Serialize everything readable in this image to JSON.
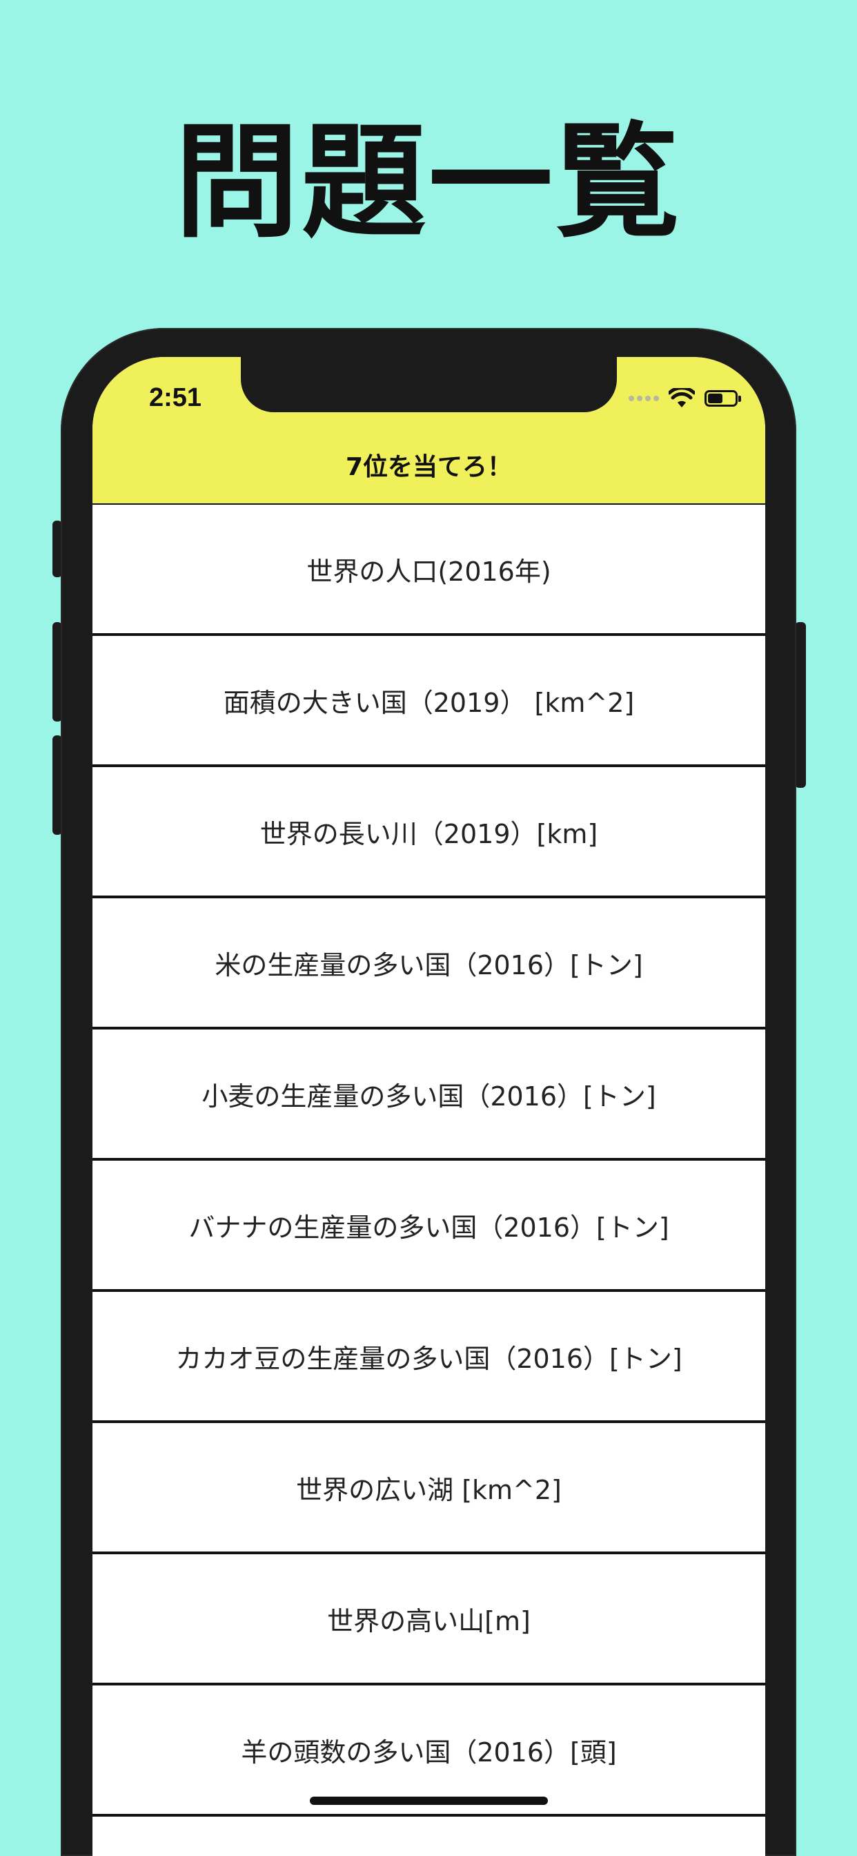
{
  "headline": "問題一覧",
  "status_bar": {
    "time": "2:51",
    "battery_level": 0.55
  },
  "navbar": {
    "title": "7位を当てろ！"
  },
  "questions": [
    {
      "label": "世界の人口(2016年)"
    },
    {
      "label": "面積の大きい国（2019） [km^2]"
    },
    {
      "label": "世界の長い川（2019）[km]"
    },
    {
      "label": "米の生産量の多い国（2016）[トン]"
    },
    {
      "label": "小麦の生産量の多い国（2016）[トン]"
    },
    {
      "label": "バナナの生産量の多い国（2016）[トン]"
    },
    {
      "label": "カカオ豆の生産量の多い国（2016）[トン]"
    },
    {
      "label": "世界の広い湖 [km^2]"
    },
    {
      "label": "世界の高い山[m]"
    },
    {
      "label": "羊の頭数の多い国（2016）[頭]"
    }
  ],
  "colors": {
    "background": "#9bf5e6",
    "navbar": "#f0f05a",
    "frame": "#1b1b1b"
  },
  "icons": [
    "cellular-signal-icon",
    "wifi-icon",
    "battery-icon"
  ]
}
